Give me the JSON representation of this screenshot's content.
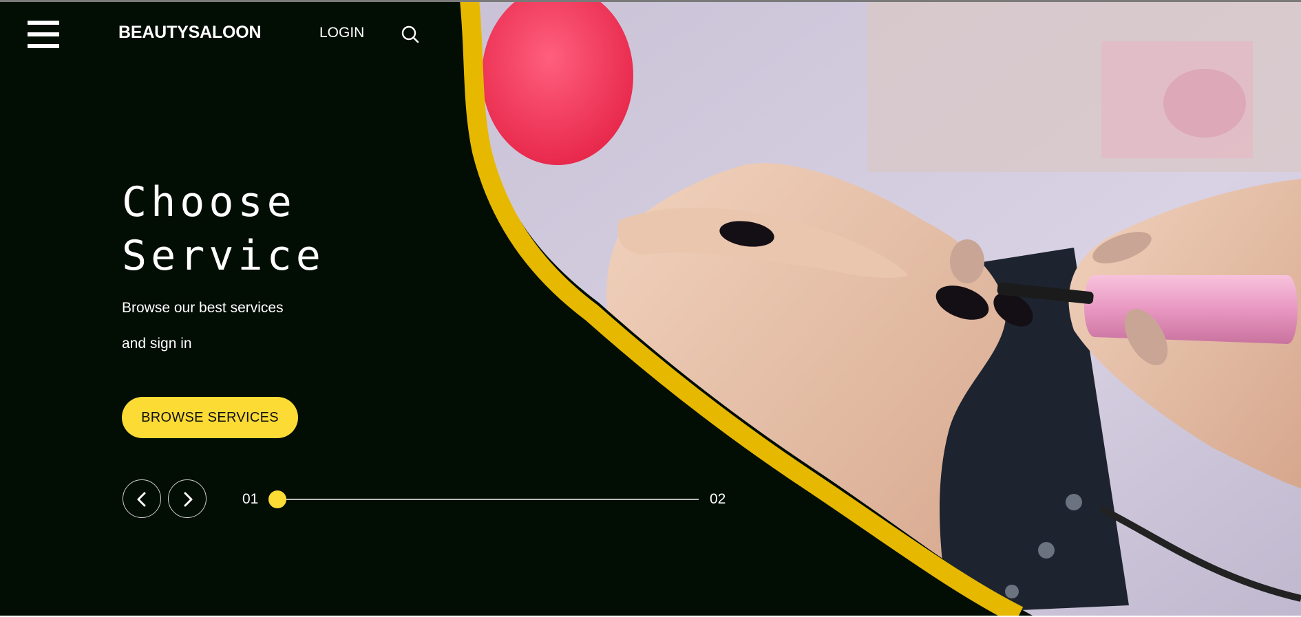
{
  "header": {
    "menu_icon": "hamburger-menu-icon",
    "brand": "BEAUTYSALOON",
    "login_label": "LOGIN",
    "search_icon": "search-icon"
  },
  "hero": {
    "title_line1": "Choose",
    "title_line2": "Service",
    "subtitle_line1": "Browse our best services",
    "subtitle_line2": "and sign in",
    "cta_label": "BROWSE SERVICES",
    "image_description_icon": "manicure-photo"
  },
  "slider": {
    "prev_icon": "chevron-left-icon",
    "next_icon": "chevron-right-icon",
    "current_label": "01",
    "total_label": "02",
    "progress": 0
  },
  "colors": {
    "background": "#020d04",
    "accent": "#fcdb35",
    "curve": "#e6b800",
    "text": "#ffffff"
  }
}
